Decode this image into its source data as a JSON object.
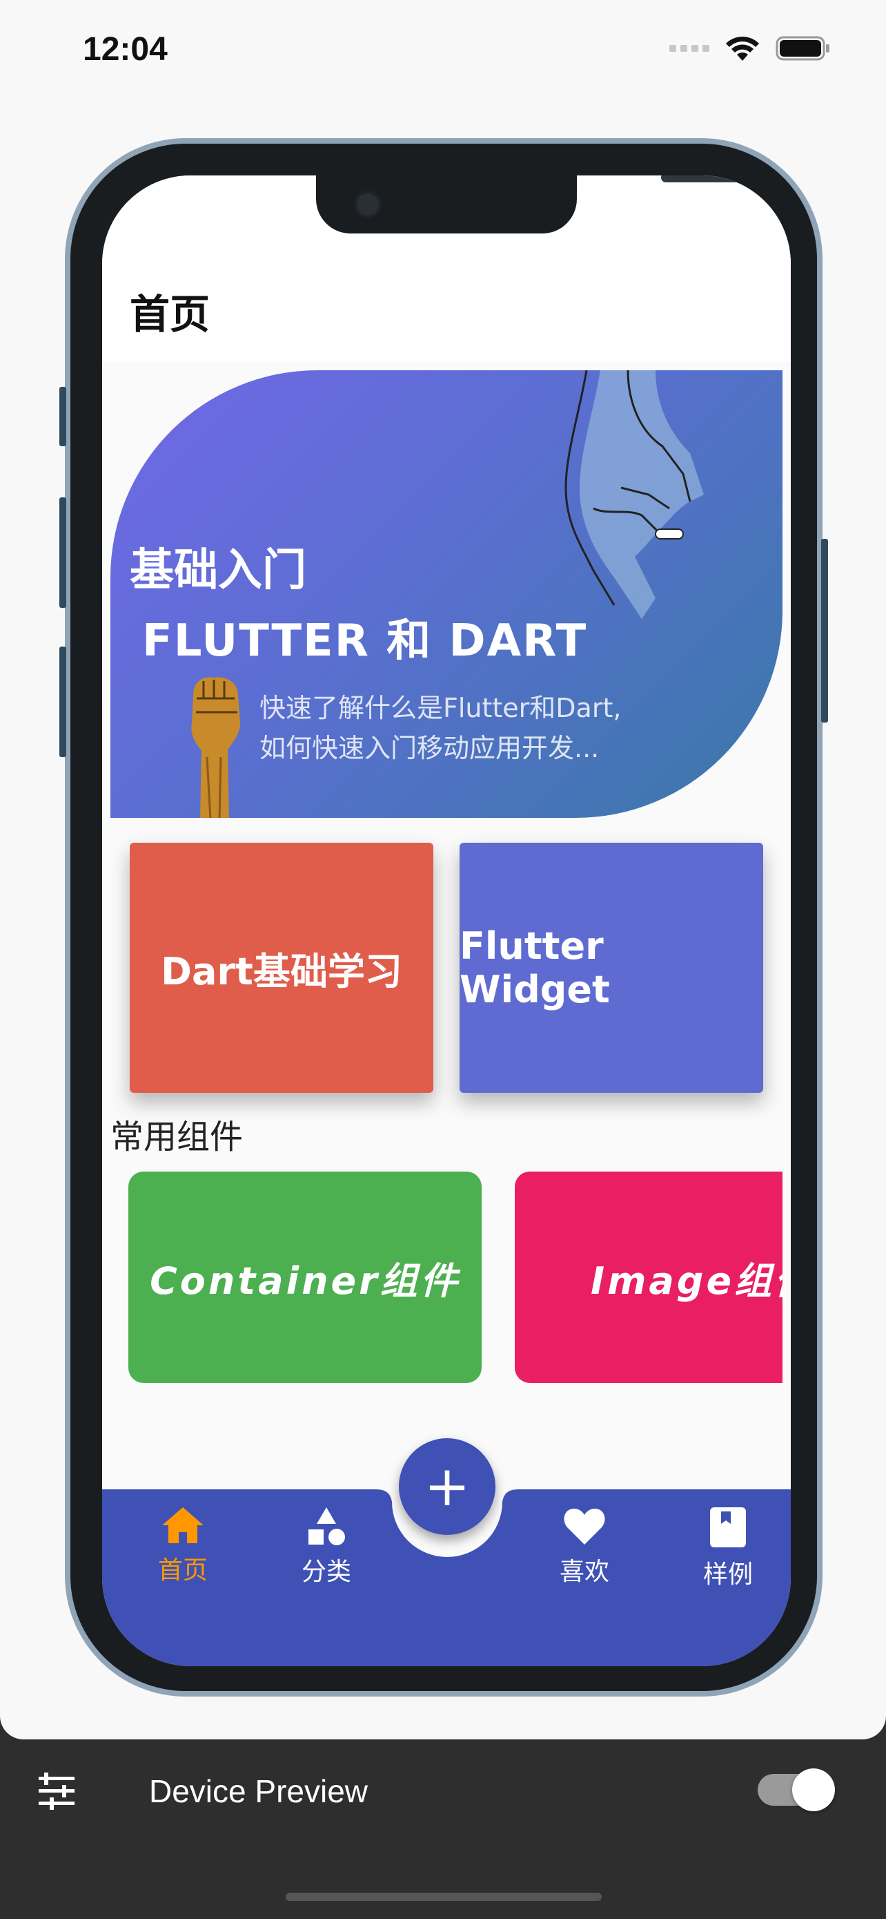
{
  "status_bar": {
    "time": "12:04",
    "icons": [
      "signal-icon",
      "wifi-icon",
      "battery-icon"
    ]
  },
  "app": {
    "title": "首页",
    "banner": {
      "title_line1": "基础入门",
      "title_line2": "FLUTTER 和 DART",
      "desc_line1": "快速了解什么是Flutter和Dart,",
      "desc_line2": "如何快速入门移动应用开发..."
    },
    "cards": [
      {
        "label": "Dart基础学习",
        "color": "#e05d4b"
      },
      {
        "label": "Flutter Widget",
        "color": "#5f6bd1"
      }
    ],
    "section_title": "常用组件",
    "components": [
      {
        "label": "Container组件",
        "color": "#4caf50"
      },
      {
        "label": "Image组件",
        "color": "#e91e63"
      }
    ],
    "fab_icon": "plus-icon",
    "bottom_nav": {
      "background": "#3f51b5",
      "active_color": "#ff9800",
      "items": [
        {
          "label": "首页",
          "icon": "home-icon",
          "active": true
        },
        {
          "label": "分类",
          "icon": "shapes-icon",
          "active": false
        },
        {
          "label": "喜欢",
          "icon": "heart-icon",
          "active": false
        },
        {
          "label": "样例",
          "icon": "book-icon",
          "active": false
        }
      ]
    }
  },
  "device_preview": {
    "label": "Device Preview",
    "toggle_on": true,
    "settings_icon": "sliders-icon"
  }
}
